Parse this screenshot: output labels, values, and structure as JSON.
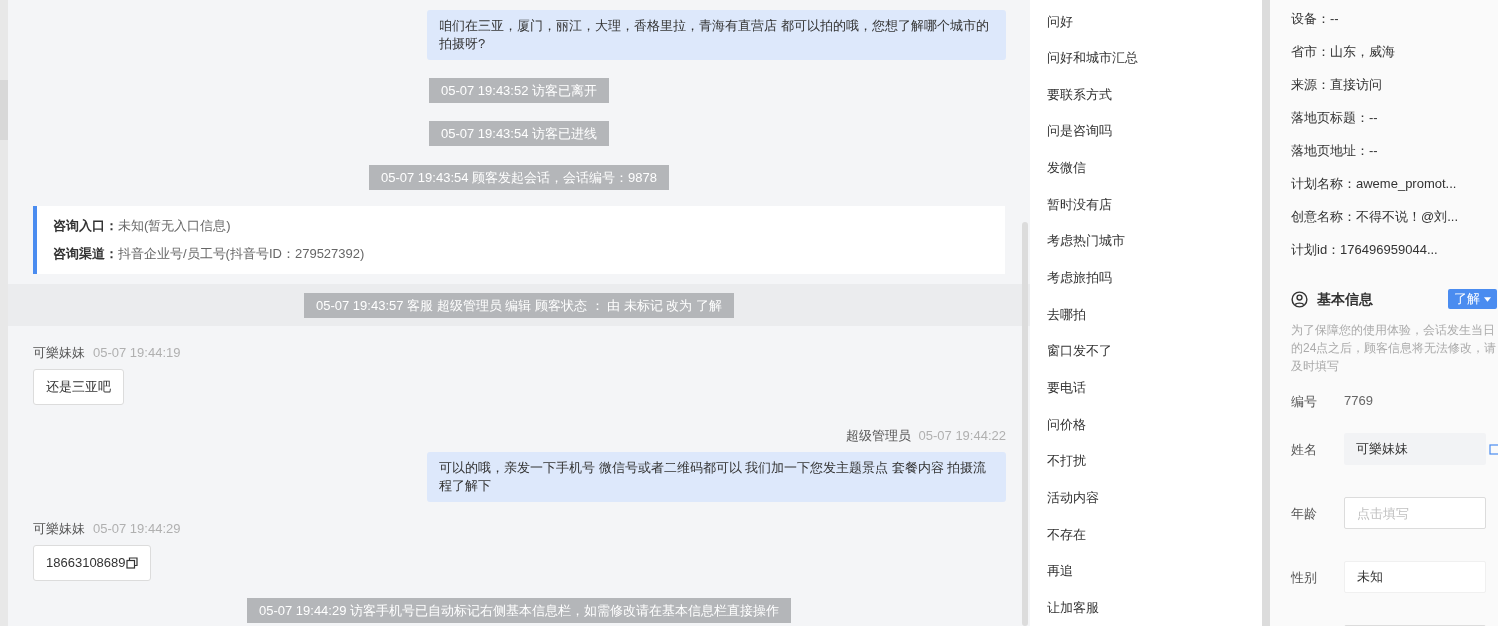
{
  "chat": {
    "messages": [
      {
        "kind": "agent",
        "text": "咱们在三亚，厦门，丽江，大理，香格里拉，青海有直营店 都可以拍的哦，您想了解哪个城市的拍摄呀?"
      },
      {
        "kind": "system",
        "text": "05-07 19:43:52 访客已离开"
      },
      {
        "kind": "system",
        "text": "05-07 19:43:54 访客已进线"
      },
      {
        "kind": "system",
        "text": "05-07 19:43:54 顾客发起会话，会话编号：9878"
      },
      {
        "kind": "info",
        "rows": [
          {
            "label": "咨询入口：",
            "value": "未知(暂无入口信息)"
          },
          {
            "label": "咨询渠道：",
            "value": "抖音企业号/员工号(抖音号ID：279527392)"
          }
        ]
      },
      {
        "kind": "status",
        "text": "05-07 19:43:57 客服 超级管理员 编辑 顾客状态 ： 由 未标记 改为 了解"
      },
      {
        "kind": "visitor",
        "name": "可樂妹妹",
        "time": "05-07 19:44:19",
        "text": "还是三亚吧"
      },
      {
        "kind": "agent",
        "name": "超级管理员",
        "time": "05-07 19:44:22",
        "text": "可以的哦，亲发一下手机号 微信号或者二维码都可以 我们加一下您发主题景点 套餐内容 拍摄流程了解下"
      },
      {
        "kind": "visitor",
        "name": "可樂妹妹",
        "time": "05-07 19:44:29",
        "text": "18663108689",
        "copy": true
      },
      {
        "kind": "system",
        "text": "05-07 19:44:29 访客手机号已自动标记右侧基本信息栏，如需修改请在基本信息栏直接操作"
      }
    ]
  },
  "quick_replies": [
    "问好",
    "问好和城市汇总",
    "要联系方式",
    "问是咨询吗",
    "发微信",
    "暂时没有店",
    "考虑热门城市",
    "考虑旅拍吗",
    "去哪拍",
    "窗口发不了",
    "要电话",
    "问价格",
    "不打扰",
    "活动内容",
    "不存在",
    "再追",
    "让加客服"
  ],
  "visitor_info": [
    "设备：--",
    "省市：山东，威海",
    "来源：直接访问",
    "落地页标题：--",
    "落地页地址：--",
    "计划名称：aweme_promot...",
    "创意名称：不得不说！@刘...",
    "计划id：176496959044..."
  ],
  "basic_info": {
    "title": "基本信息",
    "status_button": "了解",
    "notice": "为了保障您的使用体验，会话发生当日的24点之后，顾客信息将无法修改，请及时填写",
    "fields": [
      {
        "kind": "text",
        "label": "编号",
        "value": "7769"
      },
      {
        "kind": "readonly",
        "label": "姓名",
        "value": "可樂妹妹",
        "copy": true
      },
      {
        "kind": "input",
        "label": "年龄",
        "placeholder": "点击填写"
      },
      {
        "kind": "select",
        "label": "性别",
        "value": "未知"
      },
      {
        "kind": "input"
      }
    ]
  }
}
